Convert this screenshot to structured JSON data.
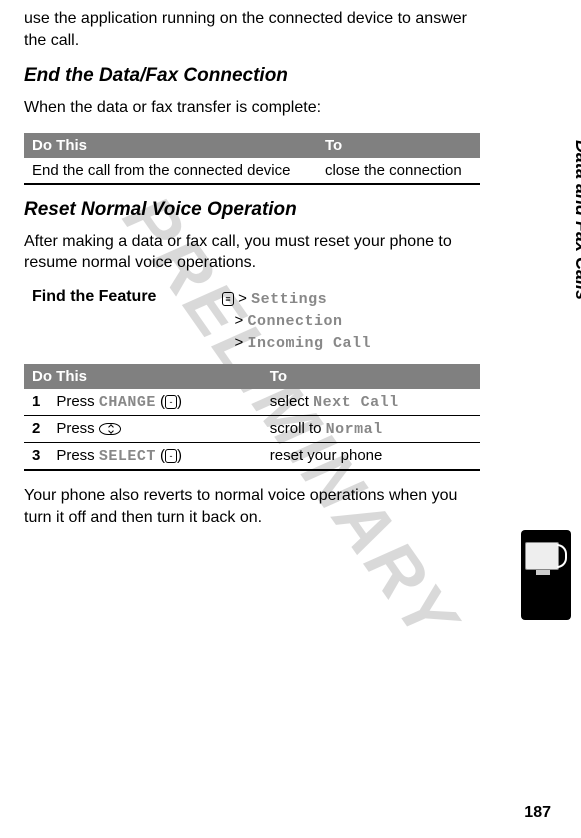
{
  "watermark": "PRELIMINARY",
  "sidetab": "Data and Fax Calls",
  "intro": "use the application running on the connected device to answer the call.",
  "section1": {
    "heading": "End the Data/Fax Connection",
    "lead": "When the data or fax transfer is complete:",
    "table": {
      "h1": "Do This",
      "h2": "To",
      "r1c1": "End the call from the connected device",
      "r1c2": "close the connection"
    }
  },
  "section2": {
    "heading": "Reset Normal Voice Operation",
    "lead": "After making a data or fax call, you must reset your phone to resume normal voice operations.",
    "find_label": "Find the Feature",
    "path1": "Settings",
    "path2": "Connection",
    "path3": "Incoming Call",
    "table": {
      "h1": "Do This",
      "h2": "To",
      "n1": "1",
      "r1a": "Press ",
      "r1b": "CHANGE",
      "r1c": "select ",
      "r1d": "Next Call",
      "n2": "2",
      "r2a": "Press ",
      "r2c": "scroll to ",
      "r2d": "Normal",
      "n3": "3",
      "r3a": "Press ",
      "r3b": "SELECT",
      "r3c": "reset your phone"
    },
    "tail": "Your phone also reverts to normal voice operations when you turn it off and then turn it back on."
  },
  "pagenum": "187"
}
